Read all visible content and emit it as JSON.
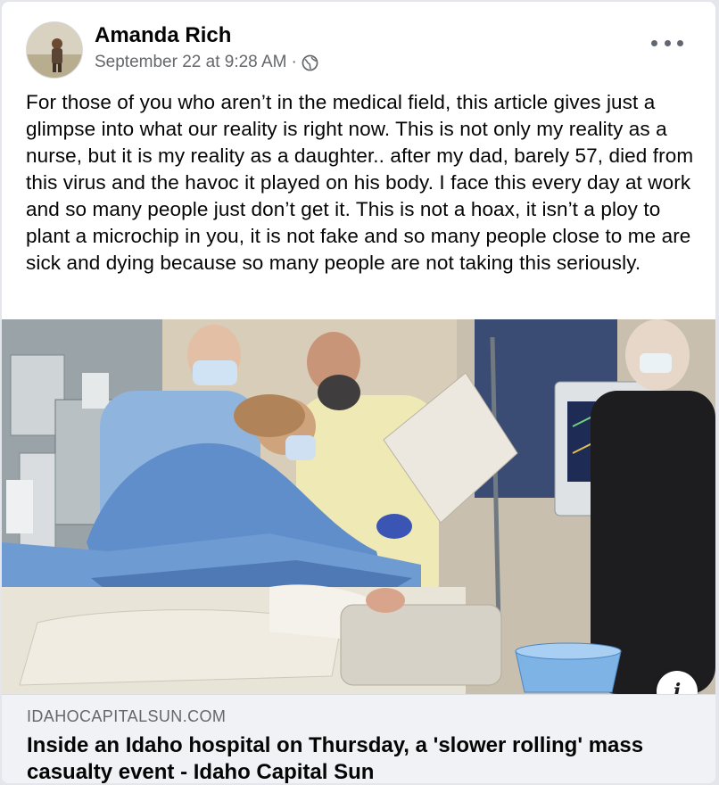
{
  "post": {
    "author": "Amanda Rich",
    "timestamp": "September 22 at 9:28 AM",
    "separator": "·",
    "privacy_icon": "globe-icon",
    "more_icon": "more-options-icon",
    "text": "For those of you who aren’t in the medical field, this article gives just a glimpse into what our reality is right now. This is not only my reality as a nurse, but it is my reality as a daughter.. after my dad, barely 57, died from this virus and the havoc it played on his body. I face this every day at work and so many people just don’t get it. This is not a hoax, it isn’t a ploy to plant a microchip in you, it is not fake and so many people close to me are sick and dying because so many people are not taking this seriously."
  },
  "link_preview": {
    "info_label": "i",
    "domain": "IDAHOCAPITALSUN.COM",
    "title": "Inside an Idaho hospital on Thursday, a 'slower rolling' mass casualty event - Idaho Capital Sun"
  },
  "colors": {
    "author_text": "#050505",
    "meta_text": "#65676b",
    "link_box_bg": "#f0f2f5",
    "scrub_blue": "#6f9bd3"
  }
}
